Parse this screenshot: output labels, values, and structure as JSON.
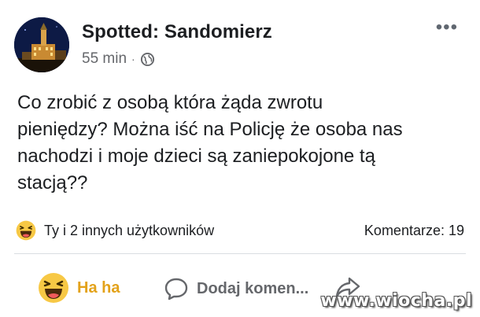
{
  "post": {
    "page_name": "Spotted: Sandomierz",
    "time": "55 min",
    "separator": "·",
    "more_menu": "•••",
    "text": "Co zrobić z osobą która żąda zwrotu\npieniędzy? Można iść na Policję że osoba nas\nnachodzi i moje dzieci są zaniepokojone tą\nstacją??",
    "reactions_text": "Ty i 2 innych użytkowników",
    "comments_text": "Komentarze: 19"
  },
  "actions": {
    "haha_label": "Ha ha",
    "comment_label": "Dodaj komen...",
    "share_icon": "share-icon"
  },
  "watermark": "www.wiocha.pl",
  "colors": {
    "haha_accent": "#e3a21a",
    "secondary_text": "#65676b",
    "primary_text": "#1c1e21"
  }
}
